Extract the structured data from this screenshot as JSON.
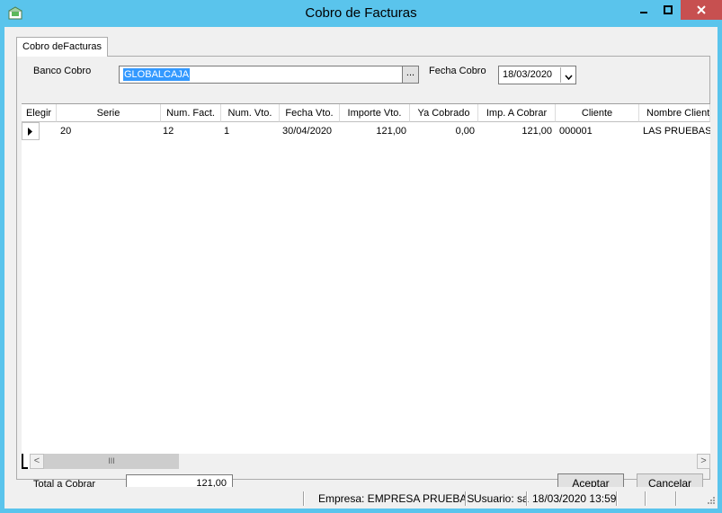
{
  "window": {
    "title": "Cobro de Facturas",
    "icons": {
      "app": "money-envelope-icon",
      "minimize": "minimize-icon",
      "maximize": "maximize-icon",
      "close": "close-icon"
    }
  },
  "tab": {
    "label": "Cobro deFacturas"
  },
  "form": {
    "banco_label": "Banco Cobro",
    "banco_value": "GLOBALCAJA",
    "browse_label": "...",
    "fecha_label": "Fecha Cobro",
    "fecha_value": "18/03/2020"
  },
  "grid": {
    "columns": [
      "Elegir",
      "Serie",
      "Num. Fact.",
      "Num. Vto.",
      "Fecha Vto.",
      "Importe Vto.",
      "Ya Cobrado",
      "Imp. A Cobrar",
      "Cliente",
      "Nombre Cliente"
    ],
    "rows": [
      {
        "serie": "20",
        "num_fact": "12",
        "num_vto": "1",
        "fecha_vto": "30/04/2020",
        "importe_vto": "121,00",
        "ya_cobrado": "0,00",
        "imp_a_cobrar": "121,00",
        "cliente": "000001",
        "nombre_cliente": "LAS PRUEBAS S"
      }
    ],
    "scrollbar": {
      "left_arrow": "<",
      "right_arrow": ">",
      "thumb_grip": "III"
    }
  },
  "footer": {
    "total_label": "Total a Cobrar",
    "total_value": "121,00",
    "accept_label": "Aceptar",
    "cancel_label": "Cancelar"
  },
  "status": {
    "empresa": "Empresa: EMPRESA PRUEBAS",
    "usuario": "Usuario: sa",
    "datetime": "18/03/2020 13:59"
  },
  "colors": {
    "titlebar": "#5ac4ec",
    "close_button": "#c75050",
    "selection": "#3399ff"
  }
}
